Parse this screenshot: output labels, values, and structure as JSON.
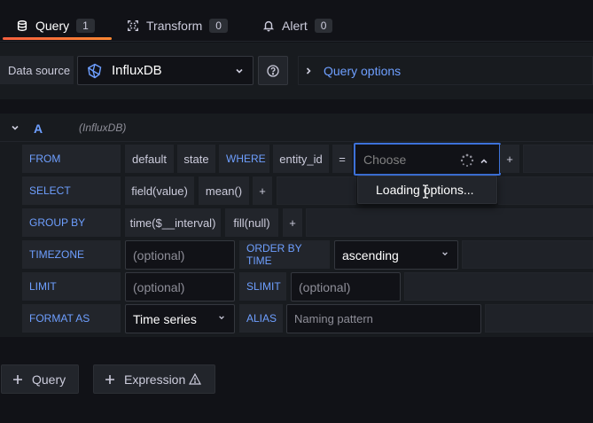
{
  "tabs": [
    {
      "label": "Query",
      "count": "1",
      "icon": "database-icon"
    },
    {
      "label": "Transform",
      "count": "0",
      "icon": "transform-icon"
    },
    {
      "label": "Alert",
      "count": "0",
      "icon": "bell-icon"
    }
  ],
  "datasource": {
    "label": "Data source",
    "value": "InfluxDB",
    "help_icon": "question-circle-icon",
    "query_options_label": "Query options"
  },
  "query": {
    "letter": "A",
    "datasource_hint": "(InfluxDB)",
    "from": {
      "keyword": "FROM",
      "policy": "default",
      "measurement": "state",
      "where_keyword": "WHERE",
      "tag_key": "entity_id",
      "operator": "=",
      "tag_value_placeholder": "Choose",
      "add": "+"
    },
    "select": {
      "keyword": "SELECT",
      "field": "field(value)",
      "fn": "mean()",
      "add": "+"
    },
    "group_by": {
      "keyword": "GROUP BY",
      "time": "time($__interval)",
      "fill": "fill(null)",
      "add": "+"
    },
    "timezone": {
      "keyword": "TIMEZONE",
      "placeholder": "(optional)",
      "order_keyword": "ORDER BY TIME",
      "order_value": "ascending"
    },
    "limit": {
      "keyword": "LIMIT",
      "placeholder": "(optional)",
      "slimit_keyword": "SLIMIT",
      "slimit_placeholder": "(optional)"
    },
    "format": {
      "keyword": "FORMAT AS",
      "value": "Time series",
      "alias_keyword": "ALIAS",
      "alias_placeholder": "Naming pattern"
    },
    "popup": "Loading options..."
  },
  "footer": {
    "add_query": "Query",
    "add_expression": "Expression"
  },
  "colors": {
    "accent": "#6e9fff",
    "tab_underline": "#f55f3e",
    "focus_border": "#3d71d9",
    "background": "#111217"
  }
}
